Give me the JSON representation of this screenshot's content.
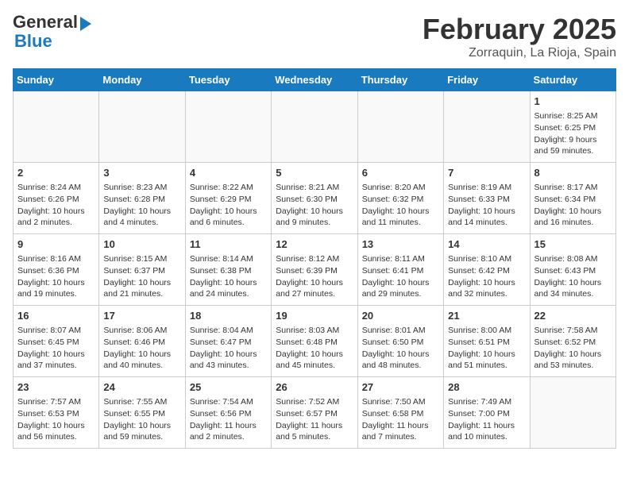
{
  "header": {
    "logo_line1": "General",
    "logo_line2": "Blue",
    "month_title": "February 2025",
    "subtitle": "Zorraquin, La Rioja, Spain"
  },
  "days_of_week": [
    "Sunday",
    "Monday",
    "Tuesday",
    "Wednesday",
    "Thursday",
    "Friday",
    "Saturday"
  ],
  "weeks": [
    [
      {
        "day": "",
        "content": ""
      },
      {
        "day": "",
        "content": ""
      },
      {
        "day": "",
        "content": ""
      },
      {
        "day": "",
        "content": ""
      },
      {
        "day": "",
        "content": ""
      },
      {
        "day": "",
        "content": ""
      },
      {
        "day": "1",
        "content": "Sunrise: 8:25 AM\nSunset: 6:25 PM\nDaylight: 9 hours and 59 minutes."
      }
    ],
    [
      {
        "day": "2",
        "content": "Sunrise: 8:24 AM\nSunset: 6:26 PM\nDaylight: 10 hours and 2 minutes."
      },
      {
        "day": "3",
        "content": "Sunrise: 8:23 AM\nSunset: 6:28 PM\nDaylight: 10 hours and 4 minutes."
      },
      {
        "day": "4",
        "content": "Sunrise: 8:22 AM\nSunset: 6:29 PM\nDaylight: 10 hours and 6 minutes."
      },
      {
        "day": "5",
        "content": "Sunrise: 8:21 AM\nSunset: 6:30 PM\nDaylight: 10 hours and 9 minutes."
      },
      {
        "day": "6",
        "content": "Sunrise: 8:20 AM\nSunset: 6:32 PM\nDaylight: 10 hours and 11 minutes."
      },
      {
        "day": "7",
        "content": "Sunrise: 8:19 AM\nSunset: 6:33 PM\nDaylight: 10 hours and 14 minutes."
      },
      {
        "day": "8",
        "content": "Sunrise: 8:17 AM\nSunset: 6:34 PM\nDaylight: 10 hours and 16 minutes."
      }
    ],
    [
      {
        "day": "9",
        "content": "Sunrise: 8:16 AM\nSunset: 6:36 PM\nDaylight: 10 hours and 19 minutes."
      },
      {
        "day": "10",
        "content": "Sunrise: 8:15 AM\nSunset: 6:37 PM\nDaylight: 10 hours and 21 minutes."
      },
      {
        "day": "11",
        "content": "Sunrise: 8:14 AM\nSunset: 6:38 PM\nDaylight: 10 hours and 24 minutes."
      },
      {
        "day": "12",
        "content": "Sunrise: 8:12 AM\nSunset: 6:39 PM\nDaylight: 10 hours and 27 minutes."
      },
      {
        "day": "13",
        "content": "Sunrise: 8:11 AM\nSunset: 6:41 PM\nDaylight: 10 hours and 29 minutes."
      },
      {
        "day": "14",
        "content": "Sunrise: 8:10 AM\nSunset: 6:42 PM\nDaylight: 10 hours and 32 minutes."
      },
      {
        "day": "15",
        "content": "Sunrise: 8:08 AM\nSunset: 6:43 PM\nDaylight: 10 hours and 34 minutes."
      }
    ],
    [
      {
        "day": "16",
        "content": "Sunrise: 8:07 AM\nSunset: 6:45 PM\nDaylight: 10 hours and 37 minutes."
      },
      {
        "day": "17",
        "content": "Sunrise: 8:06 AM\nSunset: 6:46 PM\nDaylight: 10 hours and 40 minutes."
      },
      {
        "day": "18",
        "content": "Sunrise: 8:04 AM\nSunset: 6:47 PM\nDaylight: 10 hours and 43 minutes."
      },
      {
        "day": "19",
        "content": "Sunrise: 8:03 AM\nSunset: 6:48 PM\nDaylight: 10 hours and 45 minutes."
      },
      {
        "day": "20",
        "content": "Sunrise: 8:01 AM\nSunset: 6:50 PM\nDaylight: 10 hours and 48 minutes."
      },
      {
        "day": "21",
        "content": "Sunrise: 8:00 AM\nSunset: 6:51 PM\nDaylight: 10 hours and 51 minutes."
      },
      {
        "day": "22",
        "content": "Sunrise: 7:58 AM\nSunset: 6:52 PM\nDaylight: 10 hours and 53 minutes."
      }
    ],
    [
      {
        "day": "23",
        "content": "Sunrise: 7:57 AM\nSunset: 6:53 PM\nDaylight: 10 hours and 56 minutes."
      },
      {
        "day": "24",
        "content": "Sunrise: 7:55 AM\nSunset: 6:55 PM\nDaylight: 10 hours and 59 minutes."
      },
      {
        "day": "25",
        "content": "Sunrise: 7:54 AM\nSunset: 6:56 PM\nDaylight: 11 hours and 2 minutes."
      },
      {
        "day": "26",
        "content": "Sunrise: 7:52 AM\nSunset: 6:57 PM\nDaylight: 11 hours and 5 minutes."
      },
      {
        "day": "27",
        "content": "Sunrise: 7:50 AM\nSunset: 6:58 PM\nDaylight: 11 hours and 7 minutes."
      },
      {
        "day": "28",
        "content": "Sunrise: 7:49 AM\nSunset: 7:00 PM\nDaylight: 11 hours and 10 minutes."
      },
      {
        "day": "",
        "content": ""
      }
    ]
  ]
}
